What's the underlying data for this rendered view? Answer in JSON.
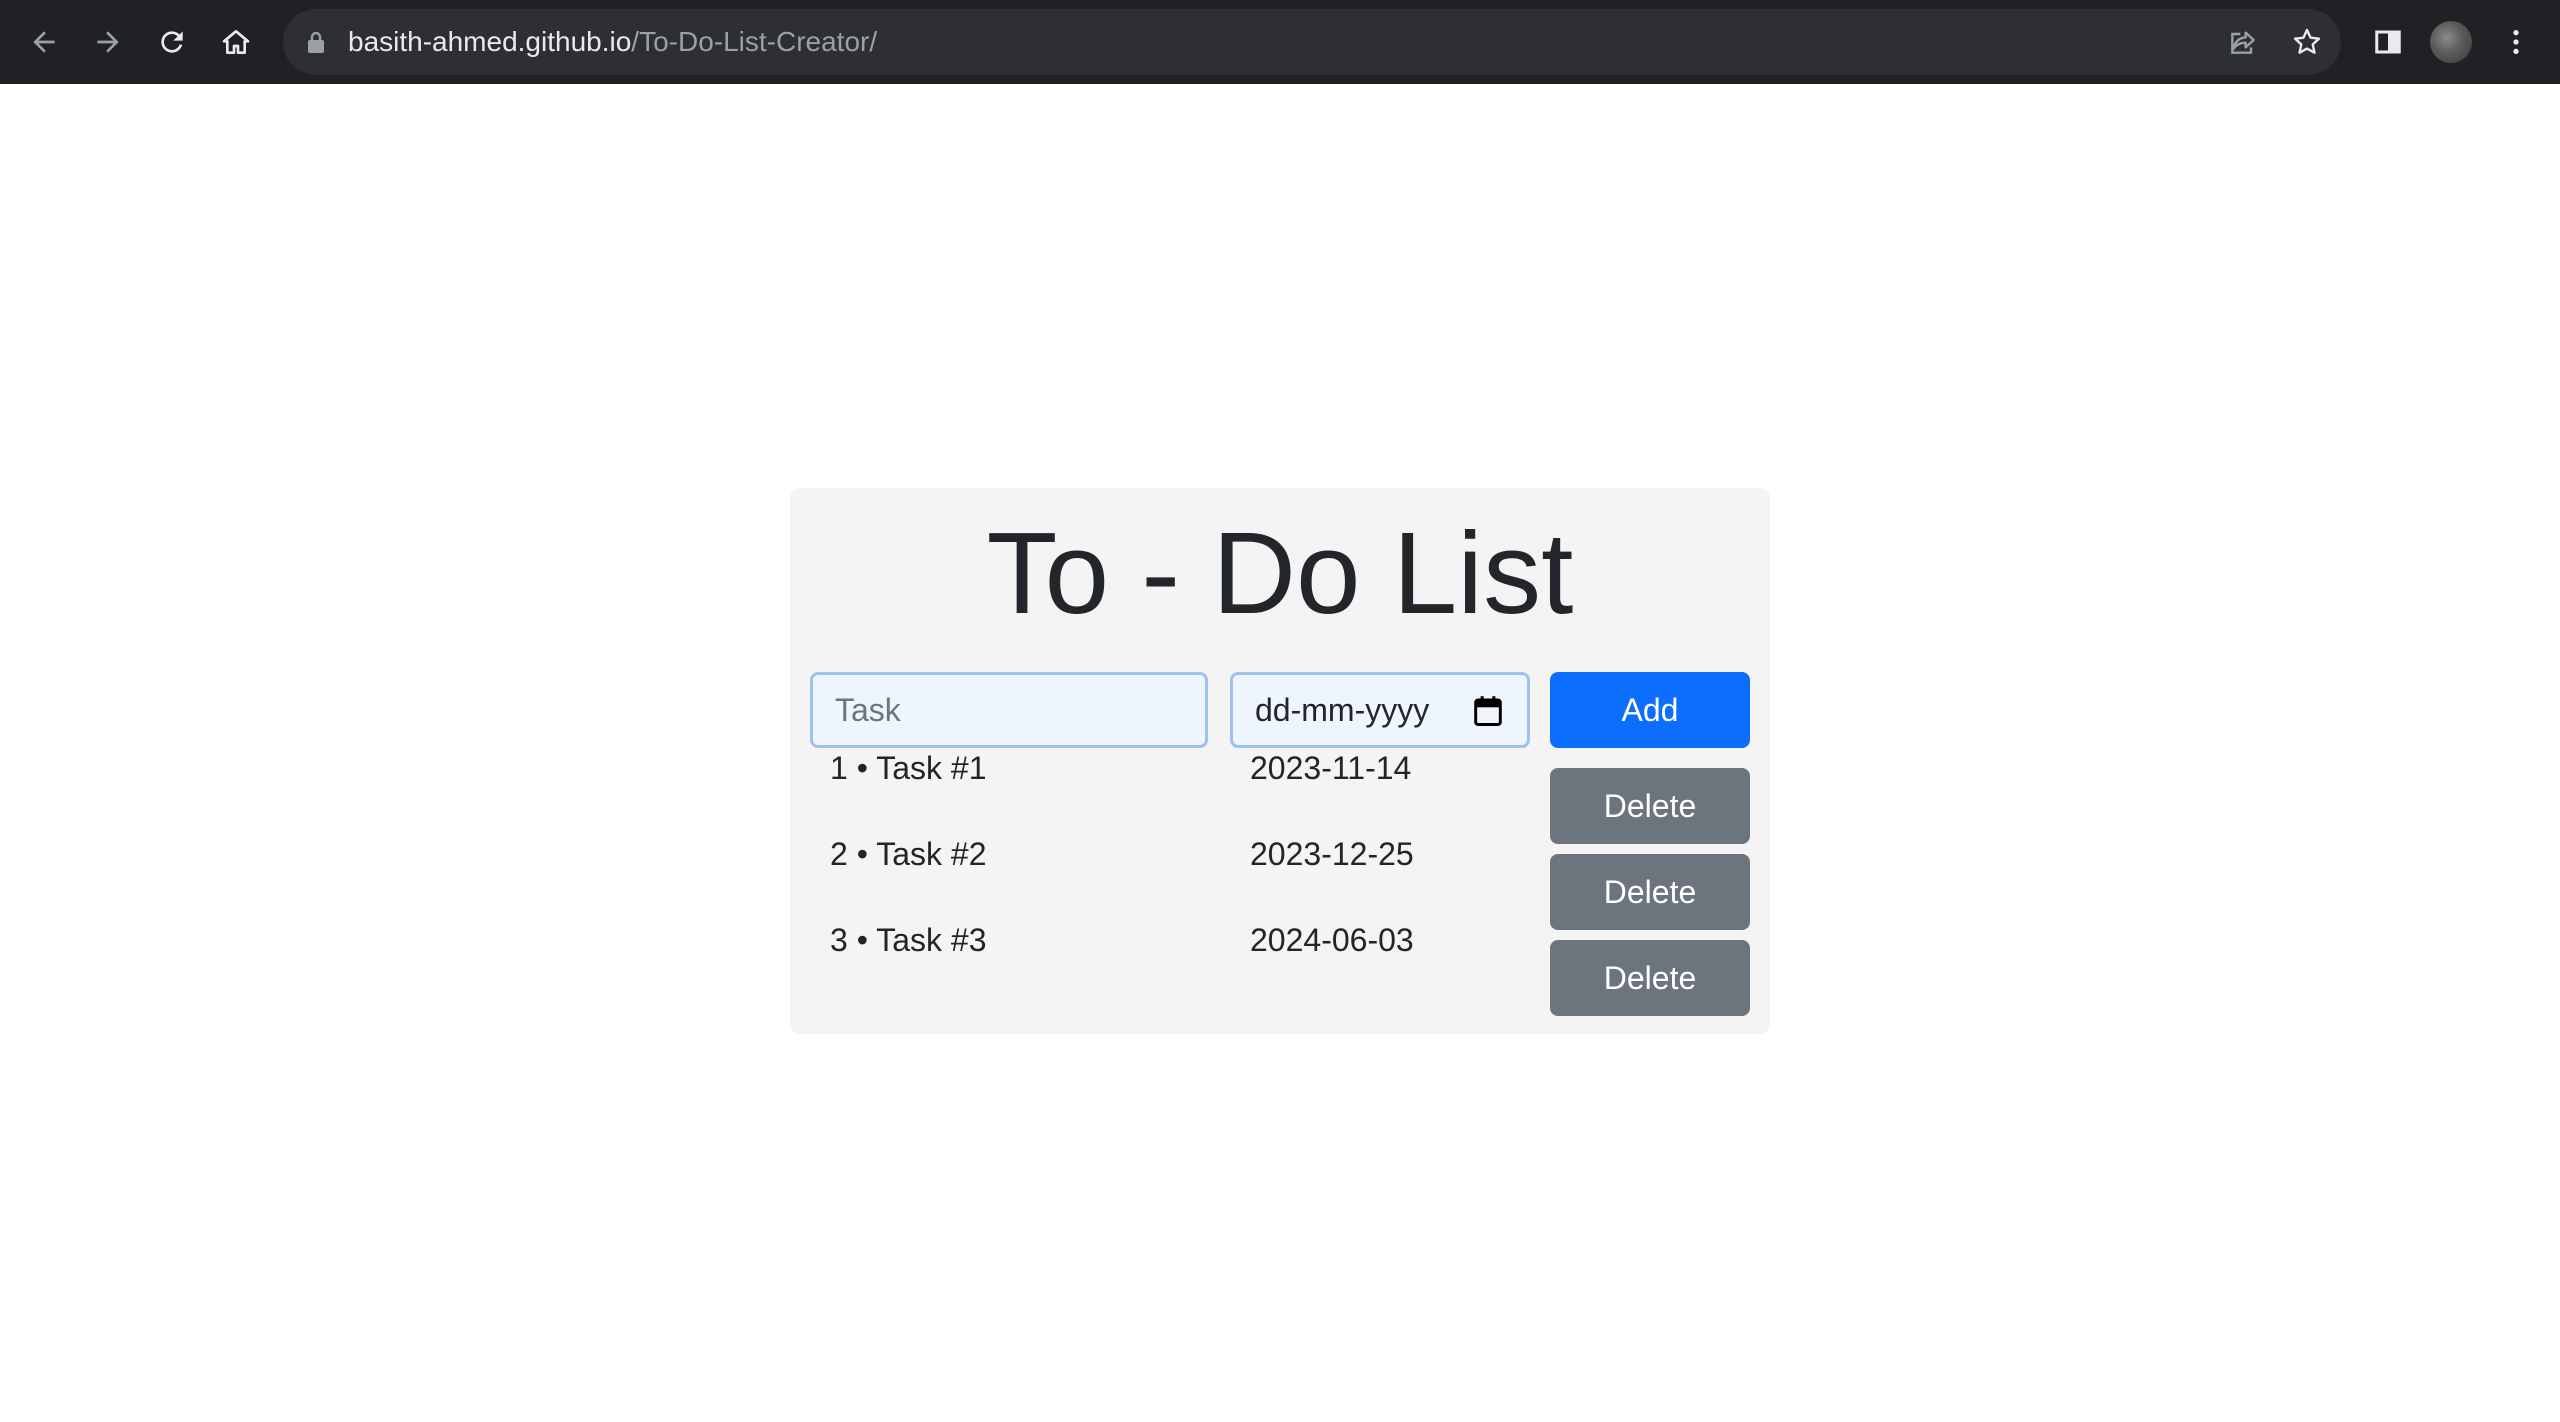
{
  "browser": {
    "url_host": "basith-ahmed.github.io",
    "url_path": "/To-Do-List-Creator/",
    "icons": {
      "back": "back-arrow-icon",
      "forward": "forward-arrow-icon",
      "reload": "reload-icon",
      "home": "home-icon",
      "lock": "lock-icon",
      "share": "share-icon",
      "bookmark": "star-icon",
      "side_panel": "side-panel-icon",
      "profile": "avatar",
      "menu": "kebab-menu-icon"
    }
  },
  "todo": {
    "title": "To - Do List",
    "task_placeholder": "Task",
    "date_placeholder": "dd-mm-yyyy",
    "add_label": "Add",
    "items": [
      {
        "name": "1 • Task #1",
        "date": "2023-11-14",
        "delete_label": "Delete"
      },
      {
        "name": "2 • Task #2",
        "date": "2023-12-25",
        "delete_label": "Delete"
      },
      {
        "name": "3 • Task #3",
        "date": "2024-06-03",
        "delete_label": "Delete"
      }
    ]
  },
  "colors": {
    "browser_bar": "#202124",
    "card_background": "#f4f4f4",
    "add_button": "#0d6efd",
    "delete_button": "#6c757d",
    "input_border": "#9ec1f0",
    "input_background": "#eef5fd"
  }
}
